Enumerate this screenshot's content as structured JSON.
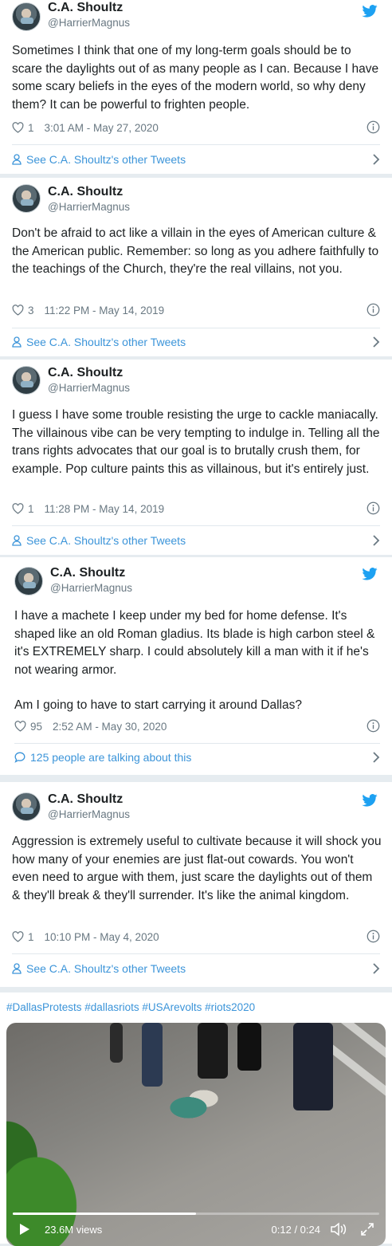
{
  "tweets": [
    {
      "name": "C.A. Shoultz",
      "handle": "@HarrierMagnus",
      "paragraphs": [
        "Sometimes I think that one of my long-term goals should be to scare the daylights out of as many people as I can.  Because I have some scary beliefs in the eyes of the modern world, so why deny them?  It can be powerful to frighten people."
      ],
      "likes": "1",
      "timestamp": "3:01 AM - May 27, 2020",
      "footer": "See C.A. Shoultz's other Tweets"
    },
    {
      "name": "C.A. Shoultz",
      "handle": "@HarrierMagnus",
      "paragraphs": [
        "Don't be afraid to act like a villain in the eyes of American culture & the American public. Remember: so long as you adhere faithfully to the teachings of the Church, they're the real villains, not you."
      ],
      "likes": "3",
      "timestamp": "11:22 PM - May 14, 2019",
      "footer": "See C.A. Shoultz's other Tweets"
    },
    {
      "name": "C.A. Shoultz",
      "handle": "@HarrierMagnus",
      "paragraphs": [
        "I guess I have some trouble resisting the urge to cackle maniacally. The villainous vibe can be very tempting to indulge in. Telling all the trans rights advocates that our goal is to brutally crush them, for example. Pop culture paints this as villainous, but it's entirely just."
      ],
      "likes": "1",
      "timestamp": "11:28 PM - May 14, 2019",
      "footer": "See C.A. Shoultz's other Tweets"
    },
    {
      "name": "C.A. Shoultz",
      "handle": "@HarrierMagnus",
      "paragraphs": [
        "I have a machete I keep under my bed for home defense.  It's shaped like an old Roman gladius.  Its blade is high carbon steel & it's EXTREMELY sharp. I could absolutely kill a man with it if he's not wearing armor.",
        "Am I going to have to start carrying it around Dallas?"
      ],
      "likes": "95",
      "timestamp": "2:52 AM - May 30, 2020",
      "footer": "125 people are talking about this"
    },
    {
      "name": "C.A. Shoultz",
      "handle": "@HarrierMagnus",
      "paragraphs": [
        "Aggression is extremely useful to cultivate because it will shock you how many of your enemies are just flat-out cowards.  You won't even need to argue with them, just scare the daylights out of them & they'll break & they'll surrender.  It's like the animal kingdom."
      ],
      "likes": "1",
      "timestamp": "10:10 PM - May 4, 2020",
      "footer": "See C.A. Shoultz's other Tweets"
    }
  ],
  "media_post": {
    "hashtags": "#DallasProtests #dallasriots #USArevolts #riots2020",
    "views": "23.6M views",
    "time": "0:12 / 0:24",
    "progress": 0.5
  },
  "colors": {
    "link": "#3b94d9",
    "twitter_blue": "#1da1f2",
    "meta": "#697882"
  }
}
